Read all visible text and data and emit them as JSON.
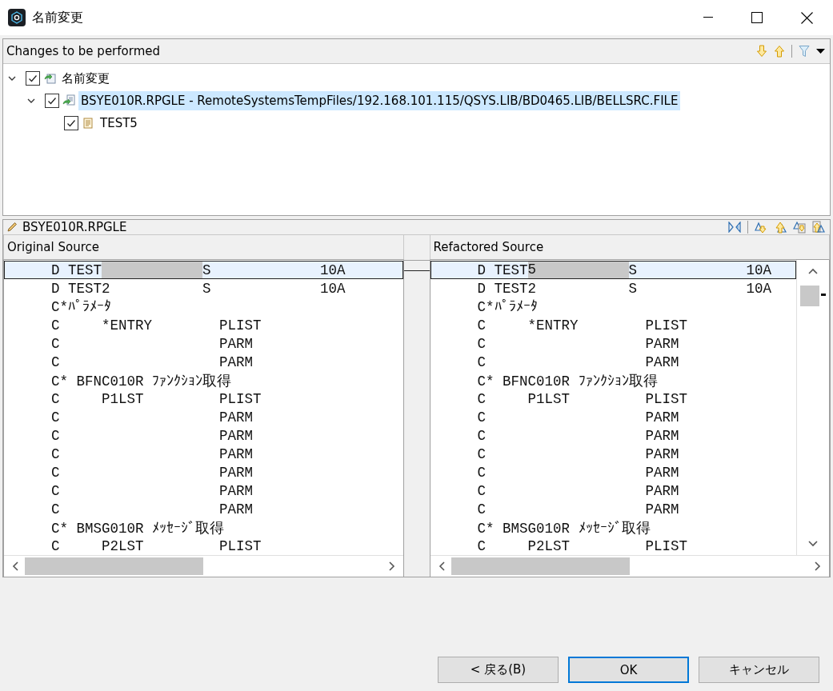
{
  "window": {
    "title": "名前変更"
  },
  "changes": {
    "title": "Changes to be performed",
    "tree": [
      {
        "label": "名前変更",
        "kind": "change-group",
        "checked": true,
        "expanded": true,
        "selected": false,
        "children": [
          {
            "label": "BSYE010R.RPGLE - RemoteSystemsTempFiles/192.168.101.115/QSYS.LIB/BD0465.LIB/BELLSRC.FILE",
            "kind": "file-change",
            "checked": true,
            "expanded": true,
            "selected": true,
            "children": [
              {
                "label": "TEST5",
                "kind": "text-edit",
                "checked": true,
                "selected": false
              }
            ]
          }
        ]
      }
    ]
  },
  "compare": {
    "title": "BSYE010R.RPGLE",
    "panes": [
      {
        "title": "Original Source",
        "lines": [
          {
            "selected": true,
            "changed": true,
            "segments": [
              {
                "text": "D TEST"
              },
              {
                "text": "S             10A"
              }
            ]
          },
          {
            "selected": false,
            "text": "D TEST2           S             10A"
          },
          {
            "selected": false,
            "text": "C*ﾊﾟﾗﾒｰﾀ"
          },
          {
            "selected": false,
            "text": "C     *ENTRY        PLIST"
          },
          {
            "selected": false,
            "text": "C                   PARM"
          },
          {
            "selected": false,
            "text": "C                   PARM"
          },
          {
            "selected": false,
            "text": "C* BFNC010R ﾌｧﾝｸｼｮﾝ取得"
          },
          {
            "selected": false,
            "text": "C     P1LST         PLIST"
          },
          {
            "selected": false,
            "text": "C                   PARM"
          },
          {
            "selected": false,
            "text": "C                   PARM"
          },
          {
            "selected": false,
            "text": "C                   PARM"
          },
          {
            "selected": false,
            "text": "C                   PARM"
          },
          {
            "selected": false,
            "text": "C                   PARM"
          },
          {
            "selected": false,
            "text": "C                   PARM"
          },
          {
            "selected": false,
            "text": "C* BMSG010R ﾒｯｾｰｼﾞ取得"
          },
          {
            "selected": false,
            "text": "C     P2LST         PLIST"
          }
        ]
      },
      {
        "title": "Refactored Source",
        "lines": [
          {
            "selected": true,
            "changed": true,
            "segments": [
              {
                "text": "D TEST"
              },
              {
                "text": "5"
              },
              {
                "text": "S             10A"
              }
            ]
          },
          {
            "selected": false,
            "text": "D TEST2           S             10A"
          },
          {
            "selected": false,
            "text": "C*ﾊﾟﾗﾒｰﾀ"
          },
          {
            "selected": false,
            "text": "C     *ENTRY        PLIST"
          },
          {
            "selected": false,
            "text": "C                   PARM"
          },
          {
            "selected": false,
            "text": "C                   PARM"
          },
          {
            "selected": false,
            "text": "C* BFNC010R ﾌｧﾝｸｼｮﾝ取得"
          },
          {
            "selected": false,
            "text": "C     P1LST         PLIST"
          },
          {
            "selected": false,
            "text": "C                   PARM"
          },
          {
            "selected": false,
            "text": "C                   PARM"
          },
          {
            "selected": false,
            "text": "C                   PARM"
          },
          {
            "selected": false,
            "text": "C                   PARM"
          },
          {
            "selected": false,
            "text": "C                   PARM"
          },
          {
            "selected": false,
            "text": "C                   PARM"
          },
          {
            "selected": false,
            "text": "C* BMSG010R ﾒｯｾｰｼﾞ取得"
          },
          {
            "selected": false,
            "text": "C     P2LST         PLIST"
          }
        ]
      }
    ]
  },
  "buttons": [
    {
      "label": "< 戻る(B)",
      "default": false
    },
    {
      "label": "OK",
      "default": true
    },
    {
      "label": "キャンセル",
      "default": false
    }
  ]
}
